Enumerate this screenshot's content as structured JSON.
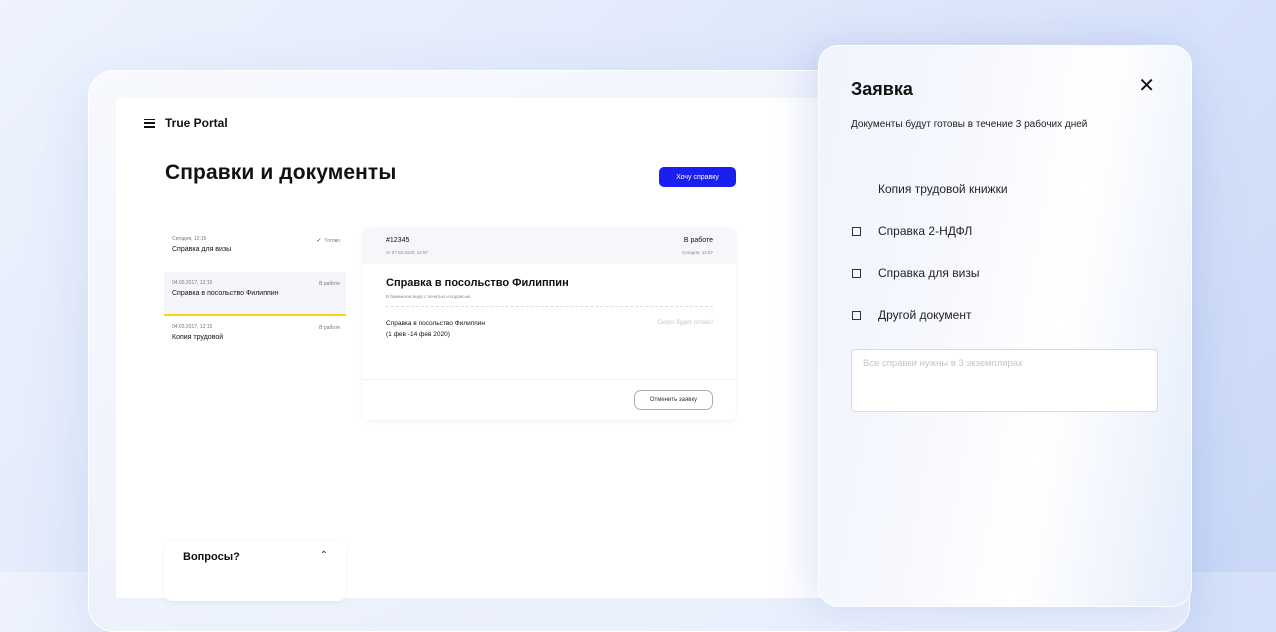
{
  "header": {
    "brand": "True Portal"
  },
  "page": {
    "title": "Справки и документы",
    "want_button": "Хочу справку"
  },
  "requests": [
    {
      "date": "Сегодня, 12:15",
      "status": "Готово",
      "name": "Справка для визы"
    },
    {
      "date": "04.03.2017, 12:15",
      "status": "В работе",
      "name": "Справка в посольство Филиппин"
    },
    {
      "date": "04.03.2017, 12:15",
      "status": "В работе",
      "name": "Копия трудовой"
    }
  ],
  "detail": {
    "number": "#12345",
    "from": "от 07.03.2020, 12:57",
    "status": "В работе",
    "today": "Сегодня, 12:57",
    "title": "Справка в посольство Филиппин",
    "subtitle": "В бумажном виде с печатью и подписью",
    "line1": "Справка в посольство Филиппин",
    "line2": "(1 фев -14 фев 2020)",
    "soon": "Скоро будет готово!",
    "cancel_button": "Отменить заявку"
  },
  "questions": {
    "label": "Вопросы?"
  },
  "panel": {
    "title": "Заявка",
    "subtitle": "Документы будут готовы в течение 3 рабочих дней",
    "options": [
      "Копия трудовой книжки",
      "Справка 2-НДФЛ",
      "Справка для визы",
      "Другой документ"
    ],
    "comment_placeholder": "Все справки нужны в 3 экземплярах"
  }
}
